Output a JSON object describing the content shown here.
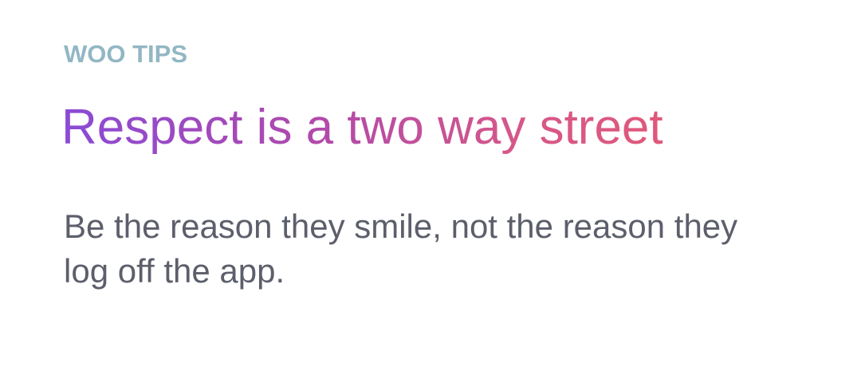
{
  "tip": {
    "eyebrow": "WOO TIPS",
    "headline": "Respect is a two way street",
    "body": "Be the reason they smile, not the reason they log off the app."
  },
  "colors": {
    "eyebrow": "#92b7c4",
    "headline_gradient_start": "#8a4ad6",
    "headline_gradient_end": "#e0587a",
    "body": "#5c5f6b",
    "background": "#ffffff"
  }
}
